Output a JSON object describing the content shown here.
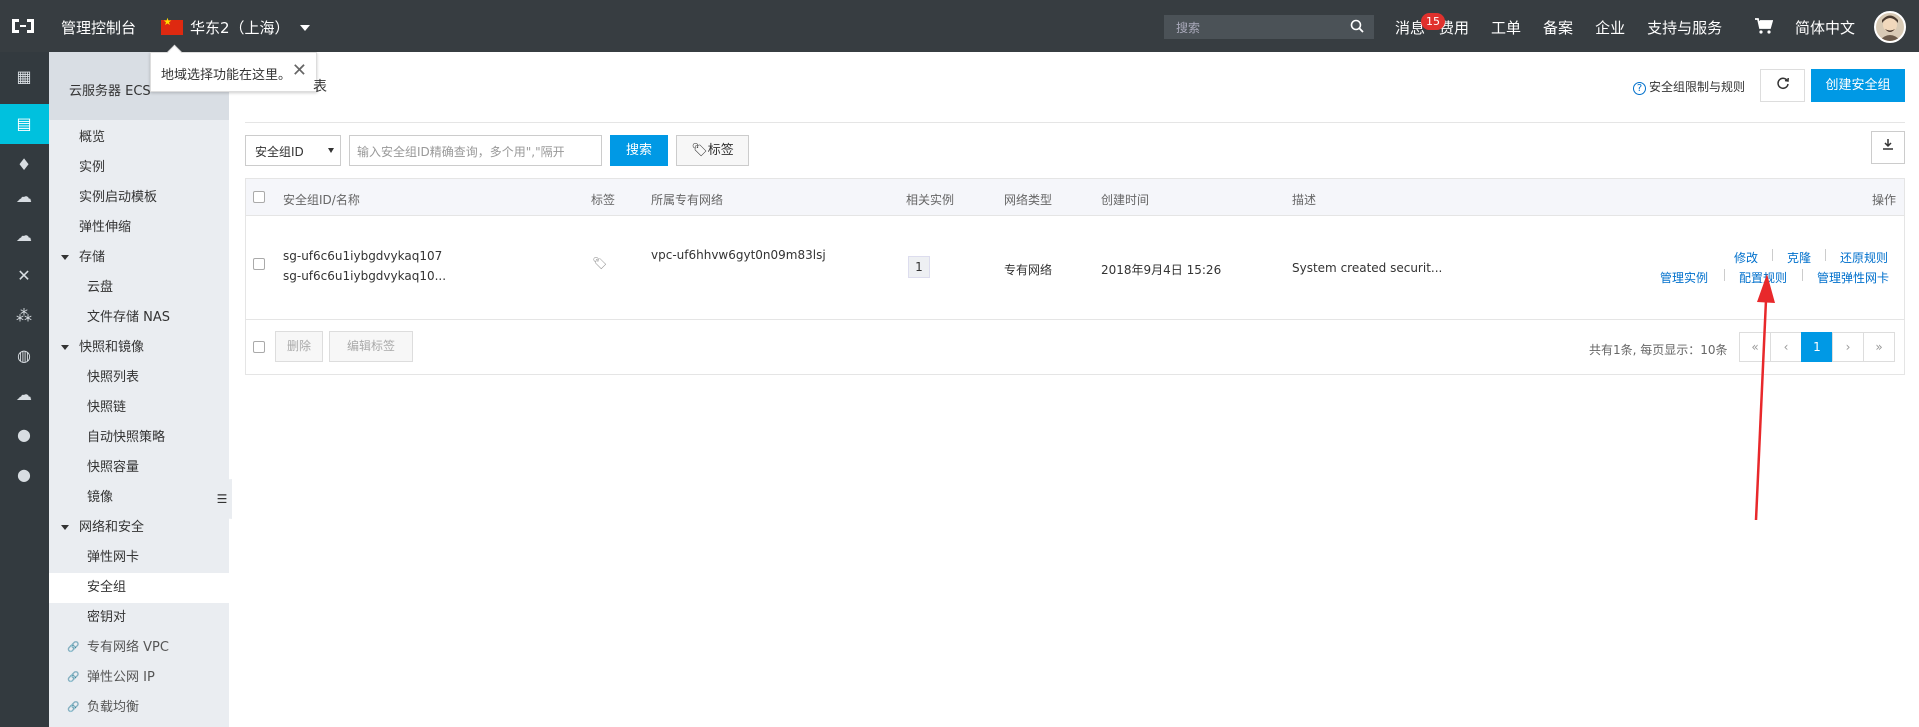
{
  "topbar": {
    "console_title": "管理控制台",
    "region": "华东2（上海）",
    "search_placeholder": "搜索",
    "nav": [
      "消息",
      "费用",
      "工单",
      "备案",
      "企业",
      "支持与服务"
    ],
    "message_badge": "15",
    "language": "简体中文"
  },
  "tooltip": {
    "text": "地域选择功能在这里。",
    "close": "✕"
  },
  "sidemenu": {
    "header": "云服务器 ECS",
    "items": [
      {
        "label": "概览"
      },
      {
        "label": "实例"
      },
      {
        "label": "实例启动模板"
      },
      {
        "label": "弹性伸缩"
      },
      {
        "label": "存储"
      },
      {
        "label": "云盘"
      },
      {
        "label": "文件存储 NAS"
      },
      {
        "label": "快照和镜像"
      },
      {
        "label": "快照列表"
      },
      {
        "label": "快照链"
      },
      {
        "label": "自动快照策略"
      },
      {
        "label": "快照容量"
      },
      {
        "label": "镜像"
      },
      {
        "label": "网络和安全"
      },
      {
        "label": "弹性网卡"
      },
      {
        "label": "安全组"
      },
      {
        "label": "密钥对"
      },
      {
        "label": "专有网络 VPC"
      },
      {
        "label": "弹性公网 IP"
      },
      {
        "label": "负载均衡"
      }
    ]
  },
  "main": {
    "page_title_fragment": "表",
    "help_link": "安全组限制与规则",
    "create_button": "创建安全组",
    "filter": {
      "select_value": "安全组ID",
      "input_placeholder": "输入安全组ID精确查询，多个用\",\"隔开",
      "search_button": "搜索",
      "tag_button": "标签"
    },
    "table": {
      "headers": [
        "安全组ID/名称",
        "标签",
        "所属专有网络",
        "相关实例",
        "网络类型",
        "创建时间",
        "描述",
        "操作"
      ],
      "rows": [
        {
          "id": "sg-uf6c6u1iybgdvykaq107",
          "name": "sg-uf6c6u1iybgdvykaq10...",
          "vpc": "vpc-uf6hhvw6gyt0n09m83lsj",
          "instances": "1",
          "network_type": "专有网络",
          "created": "2018年9月4日 15:26",
          "description": "System created securit...",
          "ops_row1": [
            "修改",
            "克隆",
            "还原规则"
          ],
          "ops_row2": [
            "管理实例",
            "配置规则",
            "管理弹性网卡"
          ]
        }
      ],
      "footer_buttons": [
        "删除",
        "编辑标签"
      ],
      "pager_text": "共有1条, 每页显示：10条",
      "pager": [
        "«",
        "‹",
        "1",
        "›",
        "»"
      ]
    }
  }
}
